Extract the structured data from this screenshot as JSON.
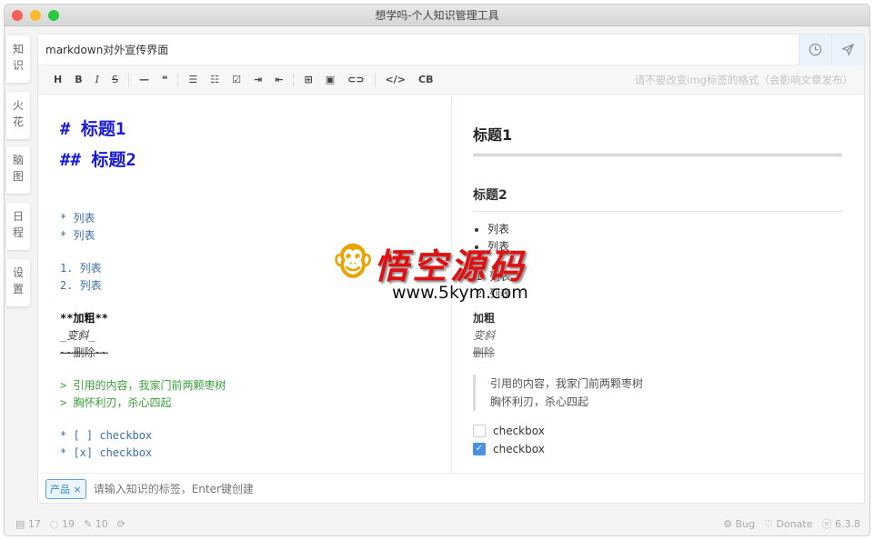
{
  "window": {
    "title": "想学吗-个人知识管理工具"
  },
  "sidebar": {
    "items": [
      {
        "label": "知识"
      },
      {
        "label": "火花"
      },
      {
        "label": "脑图"
      },
      {
        "label": "日程"
      },
      {
        "label": "设置"
      }
    ]
  },
  "doc": {
    "title": "markdown对外宣传界面"
  },
  "toolbar": {
    "buttons": [
      "H",
      "B",
      "I",
      "S",
      "—",
      "❝",
      "list",
      "ordered-list",
      "task",
      "indent",
      "outdent",
      "table",
      "image",
      "link",
      "</>",
      "CB"
    ],
    "hint": "请不要改变img标签的格式（会影响文章发布）"
  },
  "editor": {
    "lines": [
      "#  标题1",
      "##  标题2",
      "*  列表",
      "*  列表",
      "1.  列表",
      "2.  列表",
      "**加粗**",
      "_变斜_",
      "~~删除~~",
      "> 引用的内容，我家门前两颗枣树",
      "> 胸怀利刃，杀心四起",
      "* [ ] checkbox",
      "* [x] checkbox"
    ]
  },
  "preview": {
    "h1": "标题1",
    "h2": "标题2",
    "ul": [
      "列表",
      "列表"
    ],
    "ol": [
      "列表",
      "列表"
    ],
    "bold": "加粗",
    "italic": "变斜",
    "strike": "删除",
    "quote": [
      "引用的内容，我家门前两颗枣树",
      "胸怀利刃，杀心四起"
    ],
    "checkboxes": [
      {
        "label": "checkbox",
        "checked": false
      },
      {
        "label": "checkbox",
        "checked": true
      }
    ]
  },
  "tags": {
    "items": [
      "产品 ×"
    ],
    "placeholder": "请输入知识的标签，Enter键创建"
  },
  "status": {
    "docs": "17",
    "sparks": "19",
    "edits": "10",
    "bug": "Bug",
    "donate": "Donate",
    "version": "6.3.8"
  },
  "watermark": {
    "text": "悟空源码",
    "url": "www.5kym.com"
  },
  "colors": {
    "accent": "#3a86cf",
    "heading": "#1a1adb",
    "quote": "#3aa13a"
  }
}
